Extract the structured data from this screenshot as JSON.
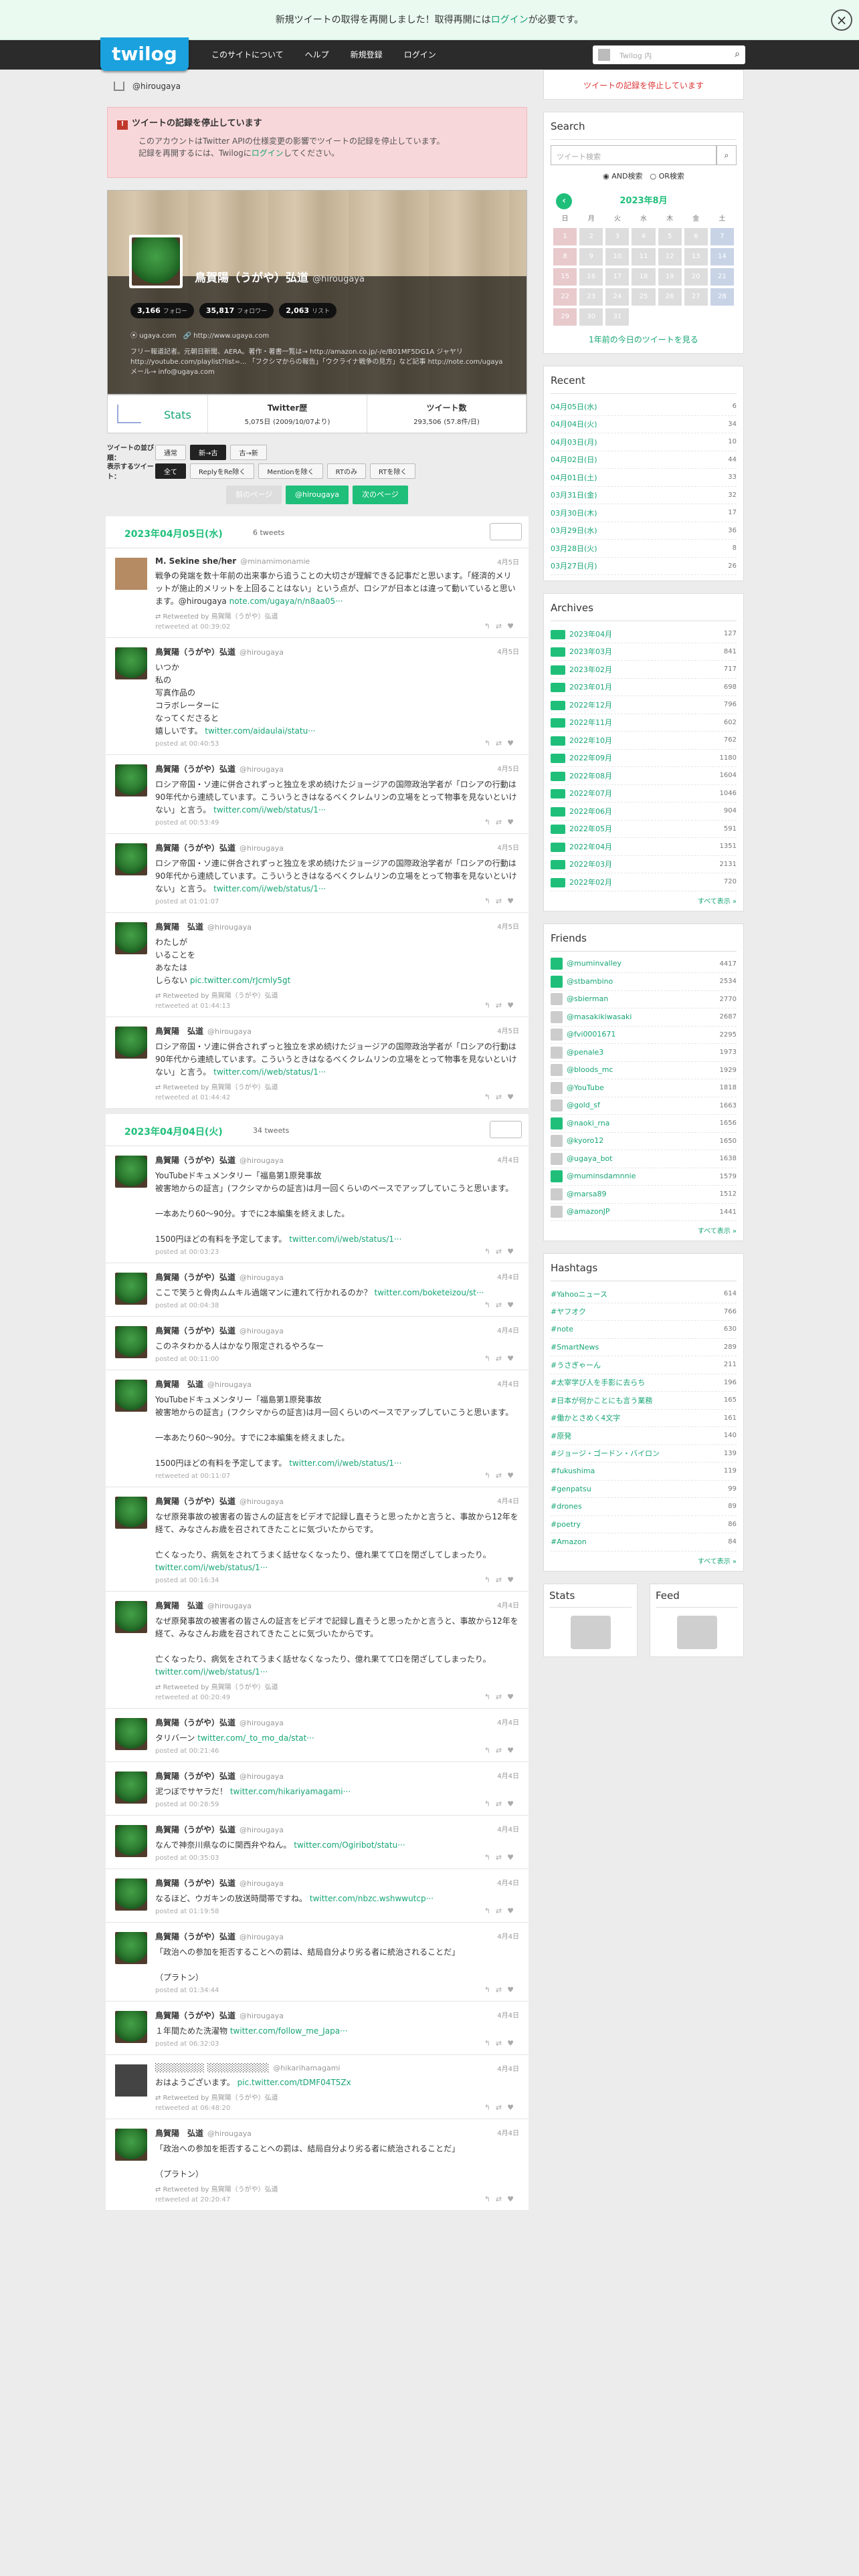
{
  "notice": {
    "text_before": "新規ツイートの取得を再開しました！取得再開には",
    "link": "ログイン",
    "text_after": "が必要です。"
  },
  "header": {
    "logo": "twilog",
    "nav": [
      "このサイトについて",
      "ヘルプ",
      "新規登録",
      "ログイン"
    ],
    "search_placeholder": "Twilog 内"
  },
  "breadcrumb": "@hirougaya",
  "warning": {
    "title": "ツイートの記録を停止しています",
    "line1": "このアカウントはTwitter APIの仕様変更の影響でツイートの記録を停止しています。",
    "line2_before": "記録を再開するには、Twilogに",
    "line2_link": "ログイン",
    "line2_after": "してください。"
  },
  "profile": {
    "name": "鳥賀陽（うがや）弘道",
    "screen": "@hirougaya",
    "follows": "3,166",
    "follows_label": "フォロー",
    "followers": "35,817",
    "followers_label": "フォロワー",
    "lists": "2,063",
    "lists_label": "リスト",
    "location": "ugaya.com",
    "url": "http://www.ugaya.com",
    "bio": "フリー報道記者。元朝日新聞、AERA。著作・著書一覧は→ http://amazon.co.jp/-/e/B01MF5DG1A ジャヤリ http://youtube.com/playlist?list=... 「フクシマからの報告」「ウクライナ戦争の見方」など記事 http://note.com/ugaya メール→ info@ugaya.com"
  },
  "stats": {
    "label": "Stats",
    "twitter_history": "Twitter歴",
    "twitter_history_value": "5,075日",
    "twitter_history_sub": "(2009/10/07より)",
    "tweets": "ツイート数",
    "tweets_value": "293,506",
    "tweets_sub": "(57.8件/日)"
  },
  "filters": {
    "tweet_select_label": "ツイートの並び順：",
    "order": [
      "通常",
      "新→古",
      "古→新"
    ],
    "show_label": "表示するツイート：",
    "show": [
      "全て",
      "ReplyをRe除く",
      "Mentionを除く",
      "RTのみ",
      "RTを除く"
    ]
  },
  "pager": {
    "prev": "前のページ",
    "user": "@hirougaya",
    "next": "次のページ"
  },
  "days": [
    {
      "date": "2023年04月05日(水)",
      "count": "6 tweets",
      "tweets": [
        {
          "name": "M. Sekine she/her",
          "screen": "@minamimonamie",
          "date": "4月5日",
          "text": "戦争の発端を数十年前の出来事から追うことの大切さが理解できる記事だと思います。「経済的メリットが施止的メリットを上回ることはない」という点が、ロシアが日本とは違って動いていると思います。@hirougaya",
          "link": "note.com/ugaya/n/n8aa05···",
          "rt": "Retweeted by 鳥賀陽（うがや）弘道",
          "posted": "retweeted at 00:39:02",
          "avatar": "#b58b63"
        },
        {
          "name": "鳥賀陽（うがや）弘道",
          "screen": "@hirougaya",
          "date": "4月5日",
          "text": "いつか\n私の\n写真作品の\nコラボレーターに\nなってくださると\n嬉しいです。",
          "link": "twitter.com/aidaulai/statu···",
          "rt": "",
          "posted": "posted at 00:40:53",
          "avatar": "frog"
        },
        {
          "name": "鳥賀陽（うがや）弘道",
          "screen": "@hirougaya",
          "date": "4月5日",
          "text": "ロシア帝国・ソ連に併合されずっと独立を求め続けたジョージアの国際政治学者が「ロシアの行動は90年代から連続しています。こういうときはなるべくクレムリンの立場をとって物事を見ないといけない」と言う。",
          "link": "twitter.com/i/web/status/1···",
          "rt": "",
          "posted": "posted at 00:53:49",
          "avatar": "frog"
        },
        {
          "name": "鳥賀陽（うがや）弘道",
          "screen": "@hirougaya",
          "date": "4月5日",
          "text": "ロシア帝国・ソ連に併合されずっと独立を求め続けたジョージアの国際政治学者が「ロシアの行動は90年代から連続しています。こういうときはなるべくクレムリンの立場をとって物事を見ないといけない」と言う。",
          "link": "twitter.com/i/web/status/1···",
          "rt": "",
          "posted": "posted at 01:01:07",
          "avatar": "frog"
        },
        {
          "name": "鳥賀陽　弘道",
          "screen": "@hirougaya",
          "date": "4月5日",
          "text": "わたしが\nいることを\nあなたは\nしらない",
          "link": "pic.twitter.com/rJcmly5gt",
          "rt": "Retweeted by 鳥賀陽（うがや）弘道",
          "posted": "retweeted at 01:44:13",
          "avatar": "frog"
        },
        {
          "name": "鳥賀陽　弘道",
          "screen": "@hirougaya",
          "date": "4月5日",
          "text": "ロシア帝国・ソ連に併合されずっと独立を求め続けたジョージアの国際政治学者が「ロシアの行動は90年代から連続しています。こういうときはなるべくクレムリンの立場をとって物事を見ないといけない」と言う。",
          "link": "twitter.com/i/web/status/1···",
          "rt": "Retweeted by 鳥賀陽（うがや）弘道",
          "posted": "retweeted at 01:44:42",
          "avatar": "frog"
        }
      ]
    },
    {
      "date": "2023年04月04日(火)",
      "count": "34 tweets",
      "tweets": [
        {
          "name": "鳥賀陽（うがや）弘道",
          "screen": "@hirougaya",
          "date": "4月4日",
          "text": "YouTubeドキュメンタリー「福島第1原発事故\n被害地からの証言」(フクシマからの証言)は月一回くらいのペースでアップしていこうと思います。\n\n一本あたり60〜90分。すでに2本編集を終えました。\n\n1500円ほどの有料を予定してます。",
          "link": "twitter.com/i/web/status/1···",
          "rt": "",
          "posted": "posted at 00:03:23",
          "avatar": "frog"
        },
        {
          "name": "鳥賀陽（うがや）弘道",
          "screen": "@hirougaya",
          "date": "4月4日",
          "text": "ここで笑うと骨肉ムムキル過端マンに連れて行かれるのか？",
          "link": "twitter.com/boketeizou/st···",
          "rt": "",
          "posted": "posted at 00:04:38",
          "avatar": "frog"
        },
        {
          "name": "鳥賀陽（うがや）弘道",
          "screen": "@hirougaya",
          "date": "4月4日",
          "text": "このネタわかる人はかなり限定されるやろなー",
          "link": "",
          "rt": "",
          "posted": "posted at 00:11:00",
          "avatar": "frog"
        },
        {
          "name": "鳥賀陽　弘道",
          "screen": "@hirougaya",
          "date": "4月4日",
          "text": "YouTubeドキュメンタリー「福島第1原発事故\n被害地からの証言」(フクシマからの証言)は月一回くらいのペースでアップしていこうと思います。\n\n一本あたり60〜90分。すでに2本編集を終えました。\n\n1500円ほどの有料を予定してます。",
          "link": "twitter.com/i/web/status/1···",
          "rt": "",
          "posted": "retweeted at 00:11:07",
          "avatar": "frog"
        },
        {
          "name": "鳥賀陽（うがや）弘道",
          "screen": "@hirougaya",
          "date": "4月4日",
          "text": "なぜ原発事故の被害者の皆さんの証言をビデオで記録し直そうと思ったかと言うと、事故から12年を経て、みなさんお歳を召されてきたことに気づいたからです。\n\n亡くなったり、病気をされてうまく話せなくなったり、億れ果てて口を閉ざしてしまったり。",
          "link": "twitter.com/i/web/status/1···",
          "rt": "",
          "posted": "posted at 00:16:34",
          "avatar": "frog"
        },
        {
          "name": "鳥賀陽　弘道",
          "screen": "@hirougaya",
          "date": "4月4日",
          "text": "なぜ原発事故の被害者の皆さんの証言をビデオで記録し直そうと思ったかと言うと、事故から12年を経て、みなさんお歳を召されてきたことに気づいたからです。\n\n亡くなったり、病気をされてうまく話せなくなったり、億れ果てて口を閉ざしてしまったり。",
          "link": "twitter.com/i/web/status/1···",
          "rt": "Retweeted by 鳥賀陽（うがや）弘道",
          "posted": "retweeted at 00:20:49",
          "avatar": "frog"
        },
        {
          "name": "鳥賀陽（うがや）弘道",
          "screen": "@hirougaya",
          "date": "4月4日",
          "text": "タリバーン",
          "link": "twitter.com/_to_mo_da/stat···",
          "rt": "",
          "posted": "posted at 00:21:46",
          "avatar": "frog"
        },
        {
          "name": "鳥賀陽（うがや）弘道",
          "screen": "@hirougaya",
          "date": "4月4日",
          "text": "泥つぼでサヤラだ！",
          "link": "twitter.com/hikariyamagami···",
          "rt": "",
          "posted": "posted at 00:28:59",
          "avatar": "frog"
        },
        {
          "name": "鳥賀陽（うがや）弘道",
          "screen": "@hirougaya",
          "date": "4月4日",
          "text": "なんで神奈川県なのに関西弁やねん。",
          "link": "twitter.com/Ogiribot/statu···",
          "rt": "",
          "posted": "posted at 00:35:03",
          "avatar": "frog"
        },
        {
          "name": "鳥賀陽（うがや）弘道",
          "screen": "@hirougaya",
          "date": "4月4日",
          "text": "なるほど、ウガキンの放送時間帯ですね。",
          "link": "twitter.com/nbzc.wshwwutcp···",
          "rt": "",
          "posted": "posted at 01:19:58",
          "avatar": "frog"
        },
        {
          "name": "鳥賀陽（うがや）弘道",
          "screen": "@hirougaya",
          "date": "4月4日",
          "text": "「政治への参加を拒否することへの罰は、結局自分より劣る者に統治されることだ」\n\n（プラトン）",
          "link": "",
          "rt": "",
          "posted": "posted at 01:34:44",
          "avatar": "frog"
        },
        {
          "name": "鳥賀陽（うがや）弘道",
          "screen": "@hirougaya",
          "date": "4月4日",
          "text": "１年間ためた洗濯物",
          "link": "twitter.com/follow_me_Japa···",
          "rt": "",
          "posted": "posted at 06:32:03",
          "avatar": "frog"
        },
        {
          "name": "░░░░░░░░ ░░░░░░░░░░",
          "screen": "@hikarihamagami",
          "date": "4月4日",
          "text": "おはようございます。",
          "link": "pic.twitter.com/tDMF04T5Zx",
          "rt": "Retweeted by 鳥賀陽（うがや）弘道",
          "posted": "retweeted at 06:48:20",
          "avatar": "#444"
        },
        {
          "name": "鳥賀陽　弘道",
          "screen": "@hirougaya",
          "date": "4月4日",
          "text": "「政治への参加を拒否することへの罰は、結局自分より劣る者に統治されることだ」\n\n（プラトン）",
          "link": "",
          "rt": "Retweeted by 鳥賀陽（うがや）弘道",
          "posted": "retweeted at 20:20:47",
          "avatar": "frog"
        }
      ]
    }
  ],
  "side": {
    "login_warning": "ツイートの記録を停止しています",
    "search": {
      "title": "Search",
      "placeholder": "ツイート検索",
      "and": "AND検索",
      "or": "OR検索"
    },
    "calendar": {
      "title": "2023年8月",
      "weekdays": [
        "日",
        "月",
        "火",
        "水",
        "木",
        "金",
        "土"
      ],
      "footer": "1年前の今日のツイートを見る"
    },
    "recent": {
      "title": "Recent",
      "items": [
        [
          "04月05日(水)",
          "6"
        ],
        [
          "04月04日(火)",
          "34"
        ],
        [
          "04月03日(月)",
          "10"
        ],
        [
          "04月02日(日)",
          "44"
        ],
        [
          "04月01日(土)",
          "33"
        ],
        [
          "03月31日(金)",
          "32"
        ],
        [
          "03月30日(木)",
          "17"
        ],
        [
          "03月29日(水)",
          "36"
        ],
        [
          "03月28日(火)",
          "8"
        ],
        [
          "03月27日(月)",
          "26"
        ]
      ]
    },
    "archives": {
      "title": "Archives",
      "items": [
        [
          "2023年04月",
          "127"
        ],
        [
          "2023年03月",
          "841"
        ],
        [
          "2023年02月",
          "717"
        ],
        [
          "2023年01月",
          "698"
        ],
        [
          "2022年12月",
          "796"
        ],
        [
          "2022年11月",
          "602"
        ],
        [
          "2022年10月",
          "762"
        ],
        [
          "2022年09月",
          "1180"
        ],
        [
          "2022年08月",
          "1604"
        ],
        [
          "2022年07月",
          "1046"
        ],
        [
          "2022年06月",
          "904"
        ],
        [
          "2022年05月",
          "591"
        ],
        [
          "2022年04月",
          "1351"
        ],
        [
          "2022年03月",
          "2131"
        ],
        [
          "2022年02月",
          "720"
        ]
      ],
      "more": "すべて表示 »"
    },
    "friends": {
      "title": "Friends",
      "items": [
        [
          "@muminvalley",
          "4417",
          "#1fbf7a"
        ],
        [
          "@stbambino",
          "2534",
          "#1fbf7a"
        ],
        [
          "@sbierman",
          "2770",
          "#ccc"
        ],
        [
          "@masakikiwasaki",
          "2687",
          "#ccc"
        ],
        [
          "@fvi0001671",
          "2295",
          "#ccc"
        ],
        [
          "@penale3",
          "1973",
          "#ccc"
        ],
        [
          "@bloods_mc",
          "1929",
          "#ccc"
        ],
        [
          "@YouTube",
          "1818",
          "#ccc"
        ],
        [
          "@gold_sf",
          "1663",
          "#ccc"
        ],
        [
          "@naoki_rna",
          "1656",
          "#1fbf7a"
        ],
        [
          "@kyoro12",
          "1650",
          "#ccc"
        ],
        [
          "@ugaya_bot",
          "1638",
          "#ccc"
        ],
        [
          "@muminsdamnnie",
          "1579",
          "#1fbf7a"
        ],
        [
          "@marsa89",
          "1512",
          "#ccc"
        ],
        [
          "@amazonJP",
          "1441",
          "#ccc"
        ]
      ],
      "more": "すべて表示 »"
    },
    "hashtags": {
      "title": "Hashtags",
      "items": [
        [
          "#Yahooニュース",
          "614"
        ],
        [
          "#ヤフオク",
          "766"
        ],
        [
          "#note",
          "630"
        ],
        [
          "#SmartNews",
          "289"
        ],
        [
          "#うさぎゃーん",
          "211"
        ],
        [
          "#太宰学び人を手影に去らち",
          "196"
        ],
        [
          "#日本が何かことにも言う業務",
          "165"
        ],
        [
          "#働かとさめく4文字",
          "161"
        ],
        [
          "#原発",
          "140"
        ],
        [
          "#ジョージ・ゴードン・バイロン",
          "139"
        ],
        [
          "#fukushima",
          "119"
        ],
        [
          "#genpatsu",
          "99"
        ],
        [
          "#drones",
          "89"
        ],
        [
          "#poetry",
          "86"
        ],
        [
          "#Amazon",
          "84"
        ]
      ],
      "more": "すべて表示 »"
    },
    "stats_title": "Stats",
    "feed_title": "Feed"
  }
}
